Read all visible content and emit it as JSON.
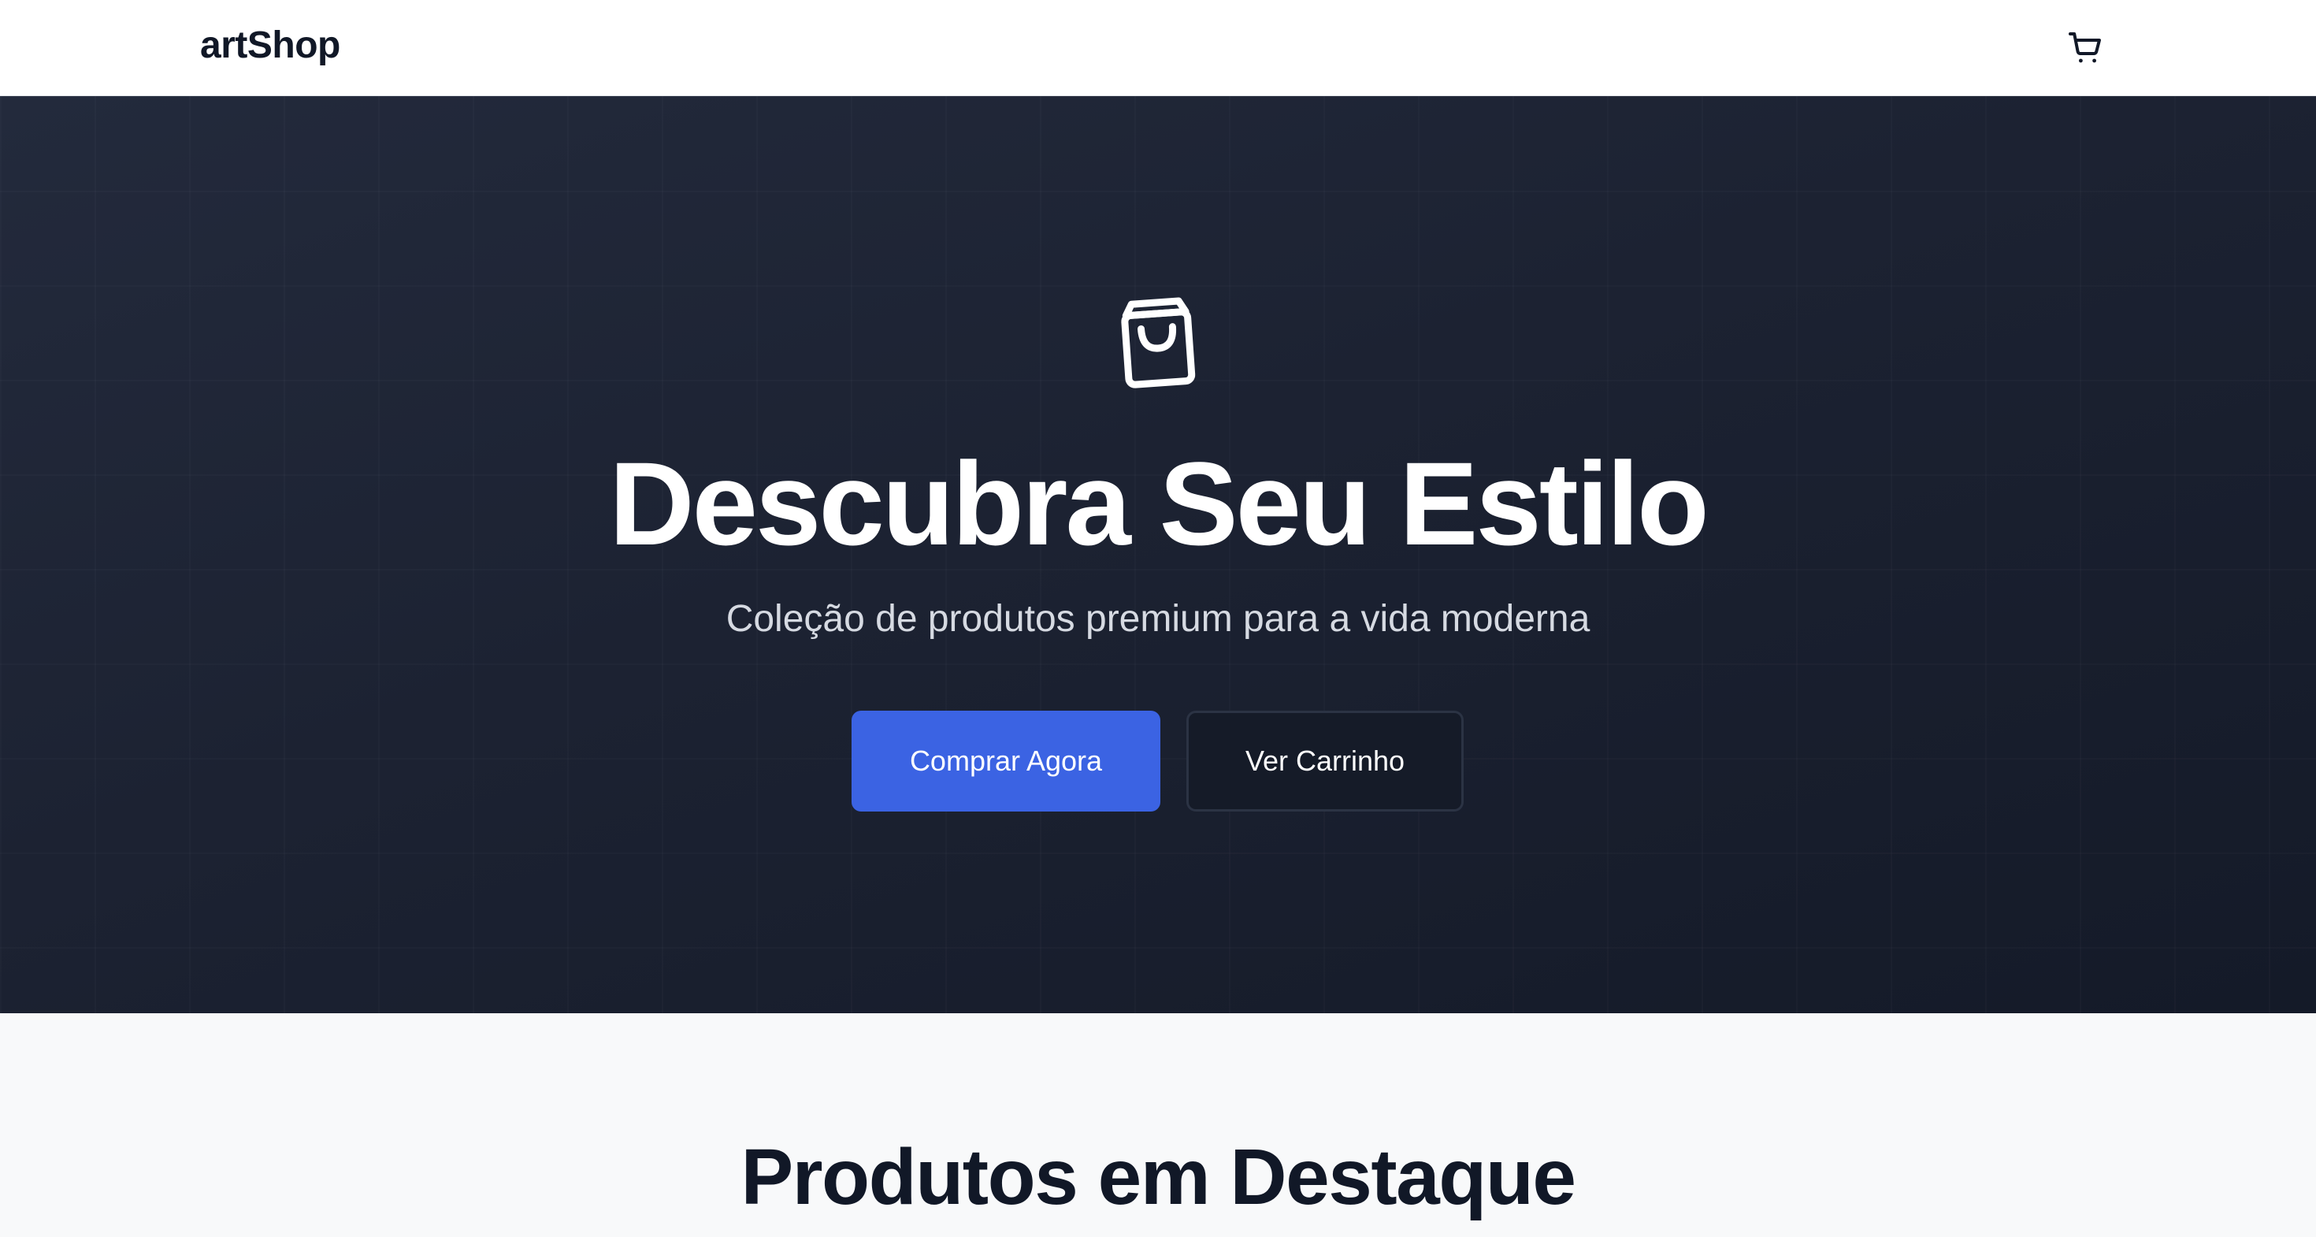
{
  "header": {
    "brand": "artShop",
    "cart_icon": "shopping-cart-icon"
  },
  "hero": {
    "icon": "shopping-bag-icon",
    "title": "Descubra Seu Estilo",
    "subtitle": "Coleção de produtos premium para a vida moderna",
    "primary_button": "Comprar Agora",
    "secondary_button": "Ver Carrinho"
  },
  "featured": {
    "title": "Produtos em Destaque"
  },
  "colors": {
    "accent": "#3b63e3",
    "hero_bg": "#1c2232",
    "text_dark": "#111827",
    "section_bg": "#f8f9fa"
  }
}
